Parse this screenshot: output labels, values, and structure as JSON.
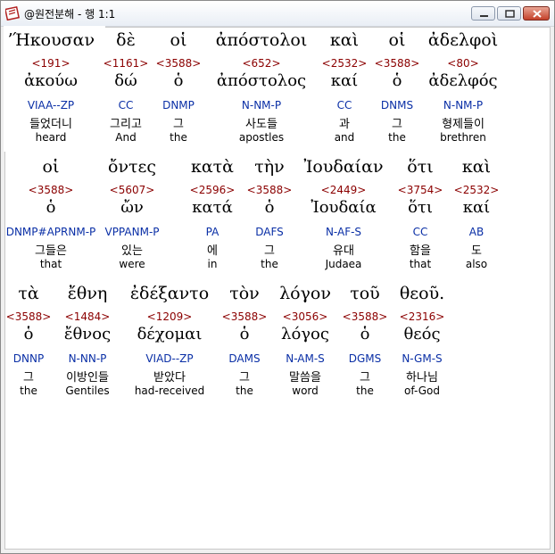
{
  "window": {
    "title": "@원전분해 - 행 1:1"
  },
  "rows": [
    [
      {
        "greek": "ʼΉκουσαν",
        "strong": "<191>",
        "lemma": "ἀκούω",
        "parse": "VIAA--ZP",
        "kor": "들었더니",
        "eng": "heard"
      },
      {
        "greek": "δὲ",
        "strong": "<1161>",
        "lemma": "δώ",
        "parse": "CC",
        "kor": "그리고",
        "eng": "And"
      },
      {
        "greek": "οἱ",
        "strong": "<3588>",
        "lemma": "ὁ",
        "parse": "DNMP",
        "kor": "그",
        "eng": "the"
      },
      {
        "greek": "ἀπόστολοι",
        "strong": "<652>",
        "lemma": "ἀπόστολος",
        "parse": "N-NM-P",
        "kor": "사도들",
        "eng": "apostles"
      },
      {
        "greek": "καὶ",
        "strong": "<2532>",
        "lemma": "καί",
        "parse": "CC",
        "kor": "과",
        "eng": "and"
      },
      {
        "greek": "οἱ",
        "strong": "<3588>",
        "lemma": "ὁ",
        "parse": "DNMS",
        "kor": "그",
        "eng": "the"
      },
      {
        "greek": "ἀδελφοὶ",
        "strong": "<80>",
        "lemma": "ἀδελφός",
        "parse": "N-NM-P",
        "kor": "형제들이",
        "eng": "brethren"
      }
    ],
    [
      {
        "greek": "οἱ",
        "strong": "<3588>",
        "lemma": "ὁ",
        "parse": "DNMP#APRNM-P",
        "kor": "그들은",
        "eng": "that"
      },
      {
        "greek": "ὄντες",
        "strong": "<5607>",
        "lemma": "ὤν",
        "parse": "VPPANM-P",
        "kor": "있는",
        "eng": "were"
      },
      {
        "greek": "κατὰ",
        "strong": "<2596>",
        "lemma": "κατά",
        "parse": "PA",
        "kor": "에",
        "eng": "in"
      },
      {
        "greek": "τὴν",
        "strong": "<3588>",
        "lemma": "ὁ",
        "parse": "DAFS",
        "kor": "그",
        "eng": "the"
      },
      {
        "greek": "Ἰουδαίαν",
        "strong": "<2449>",
        "lemma": "Ἰουδαία",
        "parse": "N-AF-S",
        "kor": "유대",
        "eng": "Judaea"
      },
      {
        "greek": "ὅτι",
        "strong": "<3754>",
        "lemma": "ὅτι",
        "parse": "CC",
        "kor": "함을",
        "eng": "that"
      },
      {
        "greek": "καὶ",
        "strong": "<2532>",
        "lemma": "καί",
        "parse": "AB",
        "kor": "도",
        "eng": "also"
      }
    ],
    [
      {
        "greek": "τὰ",
        "strong": "<3588>",
        "lemma": "ὁ",
        "parse": "DNNP",
        "kor": "그",
        "eng": "the"
      },
      {
        "greek": "ἔθνη",
        "strong": "<1484>",
        "lemma": "ἔθνος",
        "parse": "N-NN-P",
        "kor": "이방인들",
        "eng": "Gentiles"
      },
      {
        "greek": "ἐδέξαντο",
        "strong": "<1209>",
        "lemma": "δέχομαι",
        "parse": "VIAD--ZP",
        "kor": "받았다",
        "eng": "had-received"
      },
      {
        "greek": "τὸν",
        "strong": "<3588>",
        "lemma": "ὁ",
        "parse": "DAMS",
        "kor": "그",
        "eng": "the"
      },
      {
        "greek": "λόγον",
        "strong": "<3056>",
        "lemma": "λόγος",
        "parse": "N-AM-S",
        "kor": "말씀을",
        "eng": "word"
      },
      {
        "greek": "τοῦ",
        "strong": "<3588>",
        "lemma": "ὁ",
        "parse": "DGMS",
        "kor": "그",
        "eng": "the"
      },
      {
        "greek": "θεοῦ.",
        "strong": "<2316>",
        "lemma": "θεός",
        "parse": "N-GM-S",
        "kor": "하나님",
        "eng": "of-God"
      }
    ]
  ],
  "colors": {
    "strong": "#8b0000",
    "parse": "#0a2fa6",
    "text": "#000000"
  },
  "icons": {
    "app": "book-icon",
    "minimize": "minimize-icon",
    "maximize": "maximize-icon",
    "close": "close-icon"
  }
}
